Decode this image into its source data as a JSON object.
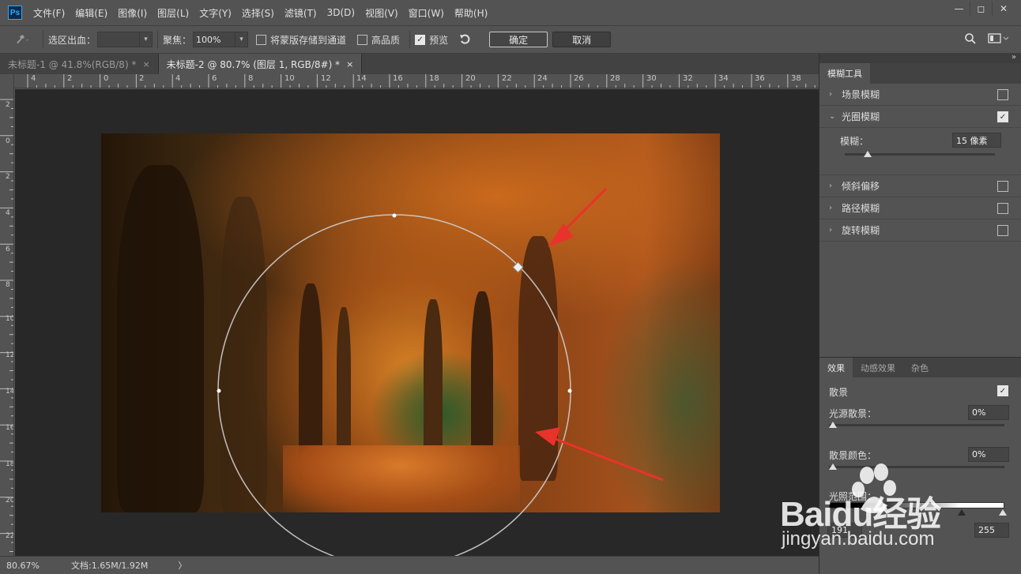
{
  "app": {
    "logo": "Ps"
  },
  "menu": [
    "文件(F)",
    "编辑(E)",
    "图像(I)",
    "图层(L)",
    "文字(Y)",
    "选择(S)",
    "滤镜(T)",
    "3D(D)",
    "视图(V)",
    "窗口(W)",
    "帮助(H)"
  ],
  "window_controls": {
    "minimize": "—",
    "restore": "◻",
    "close": "✕"
  },
  "options": {
    "selection_bleed_label": "选区出血：",
    "selection_bleed_value": "",
    "focus_label": "聚焦：",
    "focus_value": "100%",
    "save_mask_label": "将蒙版存储到通道",
    "save_mask_checked": false,
    "high_quality_label": "高品质",
    "high_quality_checked": false,
    "preview_label": "预览",
    "preview_checked": true,
    "ok_label": "确定",
    "cancel_label": "取消"
  },
  "tabs": [
    {
      "label": "未标题-1 @ 41.8%(RGB/8) *",
      "close": "×",
      "active": false
    },
    {
      "label": "未标题-2 @ 80.7% (图层 1, RGB/8#) *",
      "close": "×",
      "active": true
    }
  ],
  "ruler": {
    "top_labels": [
      "4",
      "2",
      "0",
      "2",
      "4",
      "6",
      "8",
      "10",
      "12",
      "14",
      "16",
      "18",
      "20",
      "22",
      "24",
      "26",
      "28",
      "30",
      "32",
      "34",
      "36",
      "38"
    ],
    "left_labels": [
      "2",
      "0",
      "2",
      "4",
      "6",
      "8",
      "10",
      "12",
      "14",
      "16",
      "18",
      "20",
      "22"
    ]
  },
  "status": {
    "zoom": "80.67%",
    "doc": "文档:1.65M/1.92M",
    "arrow": "〉"
  },
  "blur_tools": {
    "title": "模糊工具",
    "items": [
      {
        "label": "场景模糊",
        "checked": false,
        "expanded": false
      },
      {
        "label": "光圈模糊",
        "checked": true,
        "expanded": true
      },
      {
        "label": "倾斜偏移",
        "checked": false,
        "expanded": false
      },
      {
        "label": "路径模糊",
        "checked": false,
        "expanded": false
      },
      {
        "label": "旋转模糊",
        "checked": false,
        "expanded": false
      }
    ],
    "blur_label": "模糊：",
    "blur_value": "15 像素",
    "blur_level": 15
  },
  "effects": {
    "tabs": [
      "效果",
      "动感效果",
      "杂色"
    ],
    "bokeh_label": "散景",
    "bokeh_checked": true,
    "light_bokeh_label": "光源散景：",
    "light_bokeh_value": "0%",
    "bokeh_color_label": "散景颜色：",
    "bokeh_color_value": "0%",
    "light_range_label": "光照范围：",
    "light_range_low": "191",
    "light_range_high": "255"
  },
  "watermark": {
    "text": "Baidu经验",
    "url": "jingyan.baidu.com"
  },
  "colors": {
    "panel": "#535353",
    "canvas": "#282828",
    "accent": "#31a8ff",
    "arrow": "#e8332a"
  }
}
